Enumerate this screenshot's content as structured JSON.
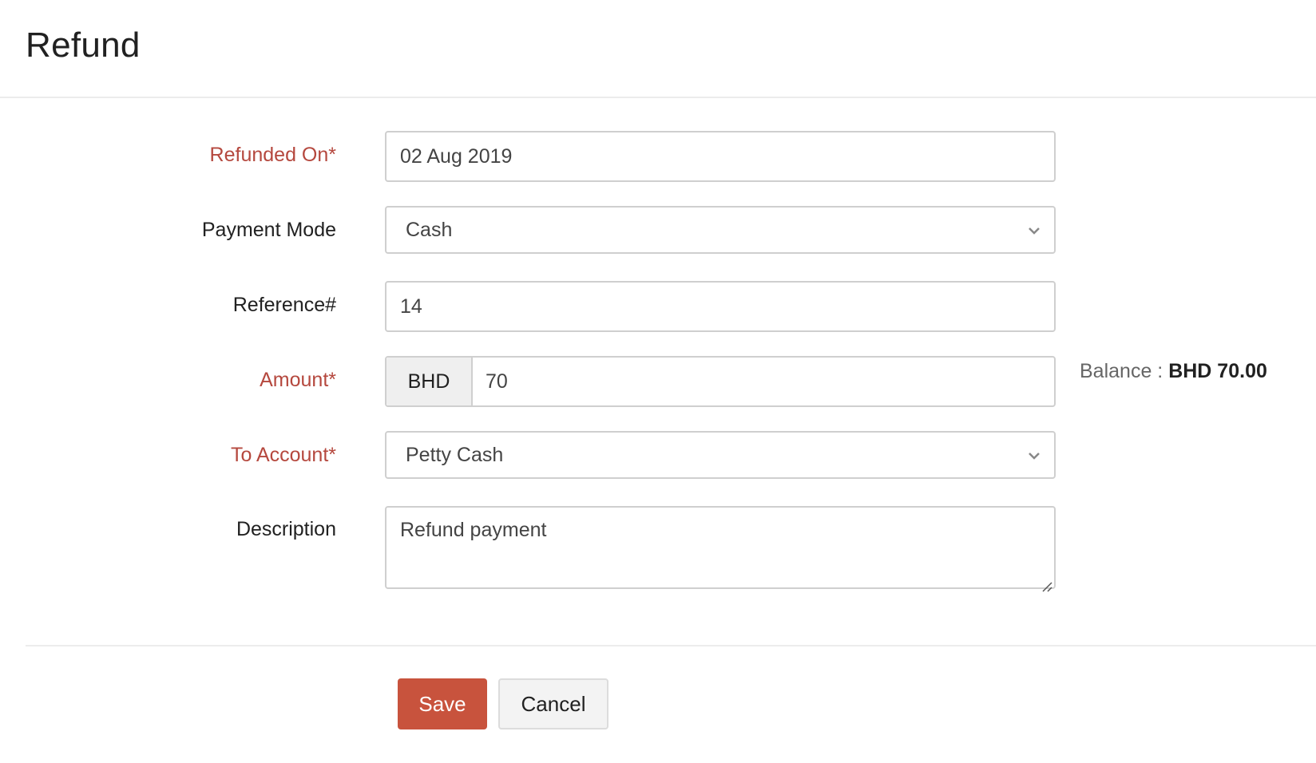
{
  "header": {
    "title": "Refund"
  },
  "form": {
    "refunded_on": {
      "label": "Refunded On*",
      "required": true,
      "value": "02 Aug 2019"
    },
    "payment_mode": {
      "label": "Payment Mode",
      "required": false,
      "value": "Cash",
      "icon": "chevron-down-icon"
    },
    "reference": {
      "label": "Reference#",
      "required": false,
      "value": "14"
    },
    "amount": {
      "label": "Amount*",
      "required": true,
      "currency": "BHD",
      "value": "70",
      "balance_label": "Balance :",
      "balance_value": "BHD 70.00"
    },
    "to_account": {
      "label": "To Account*",
      "required": true,
      "value": "Petty Cash",
      "icon": "chevron-down-icon"
    },
    "description": {
      "label": "Description",
      "required": false,
      "value": "Refund payment"
    }
  },
  "actions": {
    "save_label": "Save",
    "cancel_label": "Cancel"
  },
  "colors": {
    "required_label": "#b5483e",
    "primary_button": "#c8533d",
    "secondary_button": "#f3f3f3"
  }
}
